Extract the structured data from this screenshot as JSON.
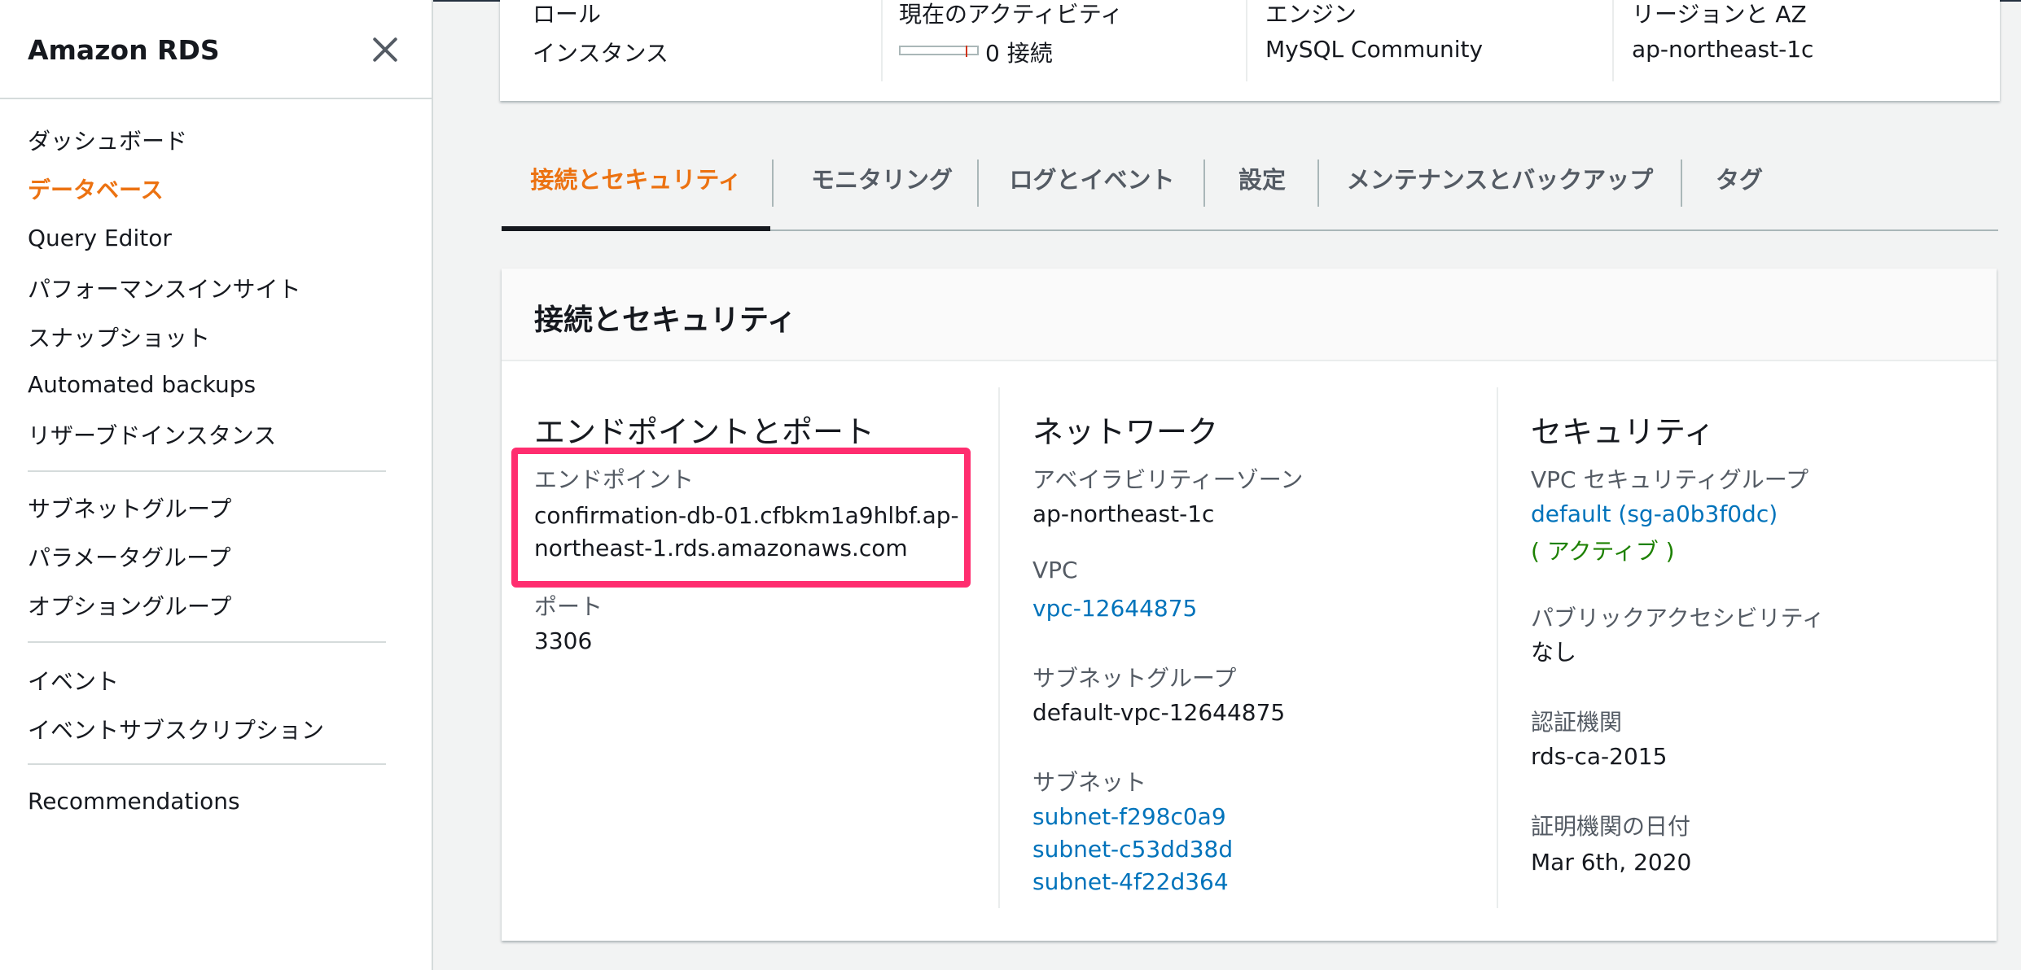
{
  "sidebar": {
    "title": "Amazon RDS",
    "items": [
      {
        "label": "ダッシュボード",
        "active": false
      },
      {
        "label": "データベース",
        "active": true
      },
      {
        "label": "Query Editor",
        "active": false
      },
      {
        "label": "パフォーマンスインサイト",
        "active": false
      },
      {
        "label": "スナップショット",
        "active": false
      },
      {
        "label": "Automated backups",
        "active": false
      },
      {
        "label": "リザーブドインスタンス",
        "active": false
      },
      {
        "label": "サブネットグループ",
        "active": false
      },
      {
        "label": "パラメータグループ",
        "active": false
      },
      {
        "label": "オプショングループ",
        "active": false
      },
      {
        "label": "イベント",
        "active": false
      },
      {
        "label": "イベントサブスクリプション",
        "active": false
      },
      {
        "label": "Recommendations",
        "active": false
      }
    ]
  },
  "summary": {
    "role": {
      "label": "ロール",
      "value": "インスタンス"
    },
    "activity": {
      "label": "現在のアクティビティ",
      "value": "0 接続"
    },
    "engine": {
      "label": "エンジン",
      "value": "MySQL Community"
    },
    "region": {
      "label": "リージョンと AZ",
      "value": "ap-northeast-1c"
    }
  },
  "tabs": [
    {
      "label": "接続とセキュリティ",
      "active": true
    },
    {
      "label": "モニタリング",
      "active": false
    },
    {
      "label": "ログとイベント",
      "active": false
    },
    {
      "label": "設定",
      "active": false
    },
    {
      "label": "メンテナンスとバックアップ",
      "active": false
    },
    {
      "label": "タグ",
      "active": false
    }
  ],
  "section": {
    "title": "接続とセキュリティ",
    "endpoint_port": {
      "heading": "エンドポイントとポート",
      "endpoint_label": "エンドポイント",
      "endpoint_line1": "confirmation-db-01.cfbkm1a9hlbf.ap-",
      "endpoint_line2": "northeast-1.rds.amazonaws.com",
      "port_label": "ポート",
      "port_value": "3306"
    },
    "network": {
      "heading": "ネットワーク",
      "az_label": "アベイラビリティーゾーン",
      "az_value": "ap-northeast-1c",
      "vpc_label": "VPC",
      "vpc_value": "vpc-12644875",
      "subnet_group_label": "サブネットグループ",
      "subnet_group_value": "default-vpc-12644875",
      "subnets_label": "サブネット",
      "subnets": [
        "subnet-f298c0a9",
        "subnet-c53dd38d",
        "subnet-4f22d364"
      ]
    },
    "security": {
      "heading": "セキュリティ",
      "sg_label": "VPC セキュリティグループ",
      "sg_value": "default (sg-a0b3f0dc)",
      "sg_status": "( アクティブ )",
      "public_label": "パブリックアクセシビリティ",
      "public_value": "なし",
      "ca_label": "認証機関",
      "ca_value": "rds-ca-2015",
      "ca_date_label": "証明機関の日付",
      "ca_date_value": "Mar 6th, 2020"
    }
  },
  "colors": {
    "accent": "#ec7211",
    "link": "#0073bb",
    "success": "#1d8102",
    "highlight": "#ff2d6f"
  }
}
